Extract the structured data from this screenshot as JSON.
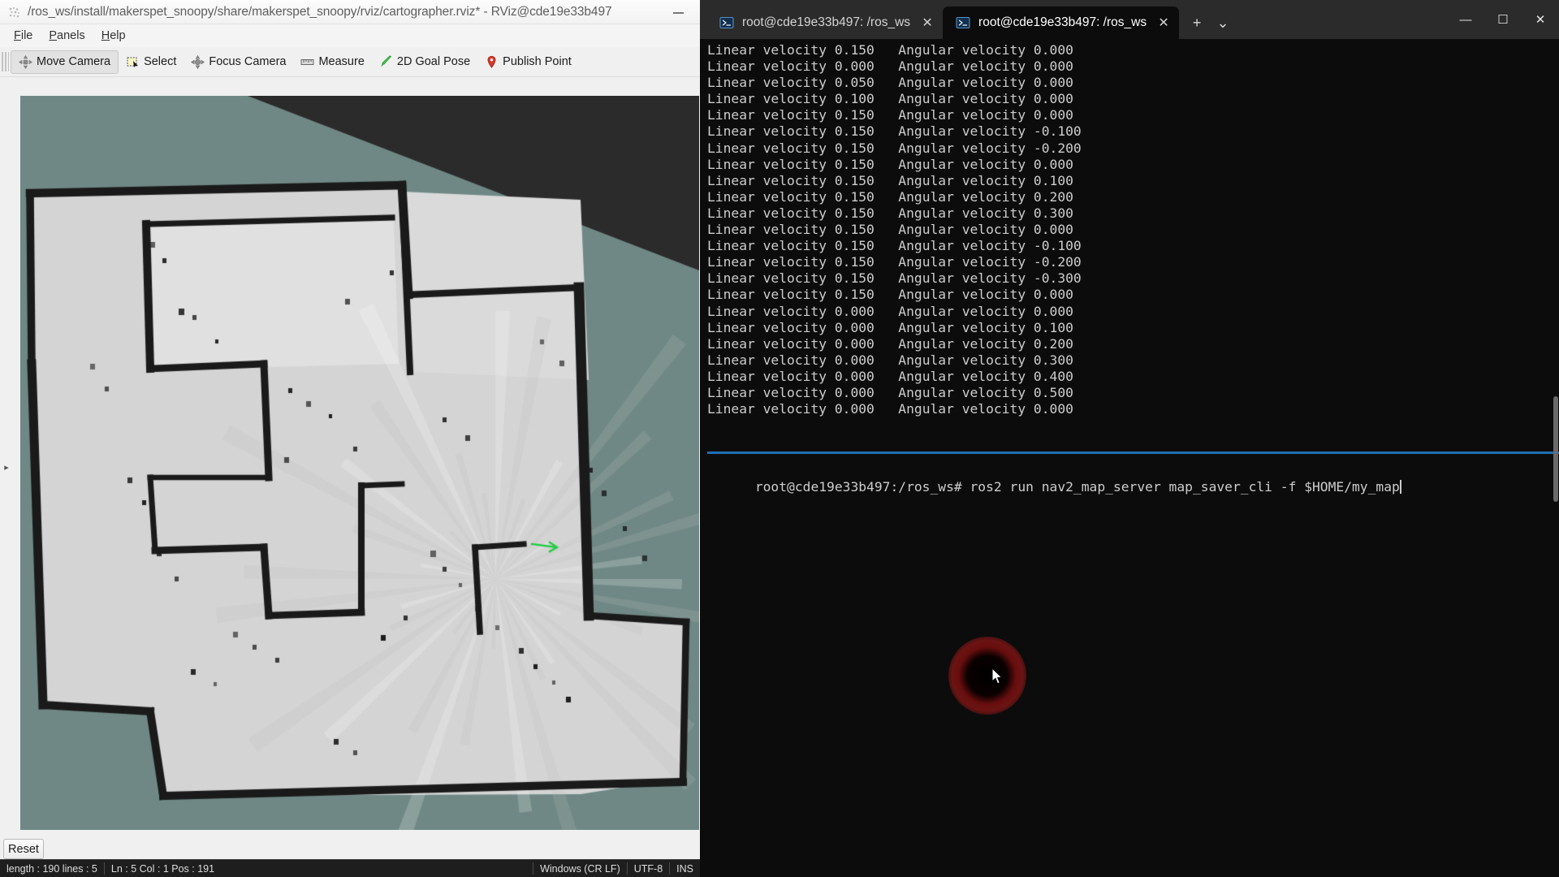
{
  "rviz": {
    "title": "/ros_ws/install/makerspet_snoopy/share/makerspet_snoopy/rviz/cartographer.rviz* - RViz@cde19e33b497",
    "app_icon": "rviz-icon",
    "minimize_label": "—",
    "menu": [
      {
        "label": "File",
        "mnemonic": "F"
      },
      {
        "label": "Panels",
        "mnemonic": "P"
      },
      {
        "label": "Help",
        "mnemonic": "H"
      }
    ],
    "toolbar": [
      {
        "label": "Move Camera",
        "icon": "move-camera-icon",
        "active": true
      },
      {
        "label": "Select",
        "icon": "select-icon",
        "active": false
      },
      {
        "label": "Focus Camera",
        "icon": "focus-camera-icon",
        "active": false
      },
      {
        "label": "Measure",
        "icon": "measure-icon",
        "active": false
      },
      {
        "label": "2D Goal Pose",
        "icon": "goal-pose-icon",
        "active": false
      },
      {
        "label": "Publish Point",
        "icon": "publish-point-icon",
        "active": false
      }
    ],
    "reset_label": "Reset",
    "render_view": {
      "background_color": "#6f8885",
      "occupied_color": "#1a1a1a",
      "free_color": "#d4d4d4",
      "robot_marker_color": "#22cc44",
      "collapse_handle": "▸"
    }
  },
  "status_bar": {
    "length_lines": "length : 190   lines : 5",
    "caret": "Ln : 5    Col : 1    Pos : 191",
    "line_ending": "Windows (CR LF)",
    "encoding": "UTF-8",
    "insert_mode": "INS"
  },
  "terminal": {
    "tabs": [
      {
        "label": "root@cde19e33b497: /ros_ws",
        "icon": "powershell-icon",
        "active": false,
        "close": "✕"
      },
      {
        "label": "root@cde19e33b497: /ros_ws",
        "icon": "powershell-icon",
        "active": true,
        "close": "✕"
      }
    ],
    "new_tab_label": "+",
    "tab_menu_label": "⌄",
    "window_controls": {
      "minimize": "—",
      "maximize": "☐",
      "close": "✕"
    },
    "prompt": "root@cde19e33b497:/ros_ws# ",
    "command": "ros2 run nav2_map_server map_saver_cli -f $HOME/my_map",
    "foreground": "#cccccc",
    "background": "#0c0c0c",
    "accent": "#1f6fb2",
    "output_prefix_linear": "Linear velocity ",
    "output_prefix_angular": "Angular velocity ",
    "output": [
      {
        "linear": "0.150",
        "angular": "0.000"
      },
      {
        "linear": "0.000",
        "angular": "0.000"
      },
      {
        "linear": "0.050",
        "angular": "0.000"
      },
      {
        "linear": "0.100",
        "angular": "0.000"
      },
      {
        "linear": "0.150",
        "angular": "0.000"
      },
      {
        "linear": "0.150",
        "angular": "-0.100"
      },
      {
        "linear": "0.150",
        "angular": "-0.200"
      },
      {
        "linear": "0.150",
        "angular": "0.000"
      },
      {
        "linear": "0.150",
        "angular": "0.100"
      },
      {
        "linear": "0.150",
        "angular": "0.200"
      },
      {
        "linear": "0.150",
        "angular": "0.300"
      },
      {
        "linear": "0.150",
        "angular": "0.000"
      },
      {
        "linear": "0.150",
        "angular": "-0.100"
      },
      {
        "linear": "0.150",
        "angular": "-0.200"
      },
      {
        "linear": "0.150",
        "angular": "-0.300"
      },
      {
        "linear": "0.150",
        "angular": "0.000"
      },
      {
        "linear": "0.000",
        "angular": "0.000"
      },
      {
        "linear": "0.000",
        "angular": "0.100"
      },
      {
        "linear": "0.000",
        "angular": "0.200"
      },
      {
        "linear": "0.000",
        "angular": "0.300"
      },
      {
        "linear": "0.000",
        "angular": "0.400"
      },
      {
        "linear": "0.000",
        "angular": "0.500"
      },
      {
        "linear": "0.000",
        "angular": "0.000"
      }
    ]
  },
  "overlay": {
    "click_highlight_color": "#b01a1a",
    "cursor": "arrow-cursor"
  }
}
